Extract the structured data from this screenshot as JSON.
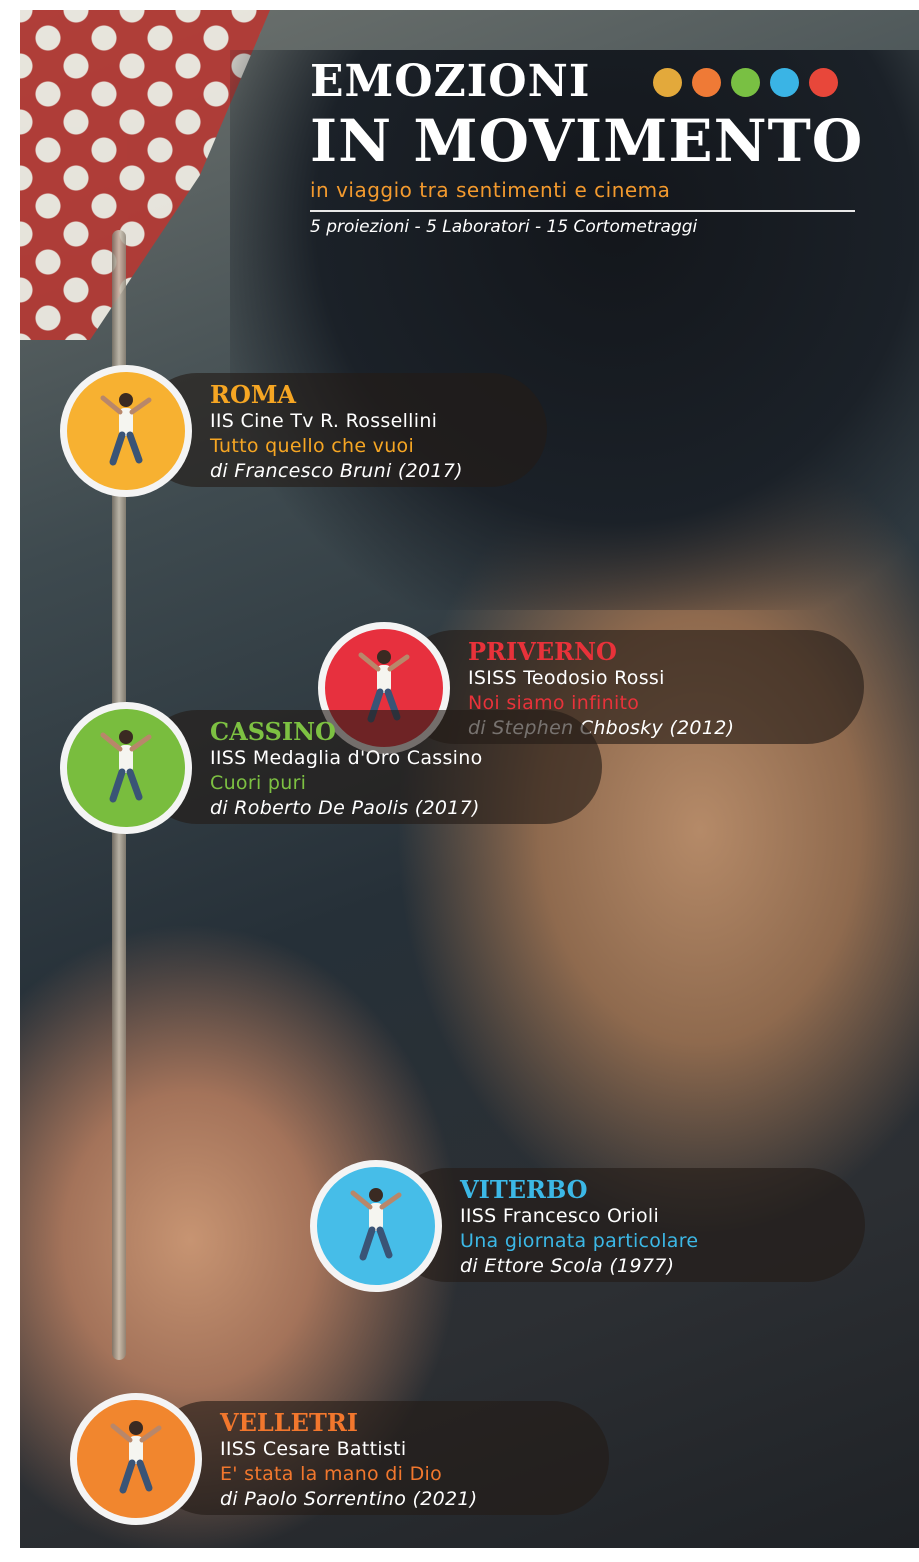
{
  "title": {
    "line1": "EMOZIONI",
    "line2": "IN MOVIMENTO",
    "tagline": "in viaggio tra sentimenti e cinema",
    "subtitle": "5 proiezioni - 5 Laboratori - 15 Cortometraggi",
    "dot_colors": [
      "#e3a93b",
      "#ef7a36",
      "#79c043",
      "#3ab4e5",
      "#e8473a"
    ]
  },
  "events": [
    {
      "city": "ROMA",
      "school": "IIS Cine Tv R. Rossellini",
      "film": "Tutto quello che vuoi",
      "director": "di Francesco Bruni (2017)",
      "color": "#f6a623",
      "circle_color": "#f7b131"
    },
    {
      "city": "PRIVERNO",
      "school": "ISISS Teodosio Rossi",
      "film": "Noi siamo infinito",
      "director": "di Stephen Chbosky (2012)",
      "color": "#e8323a",
      "circle_color": "#e7303e"
    },
    {
      "city": "CASSINO",
      "school": "IISS Medaglia d'Oro Cassino",
      "film": "Cuori puri",
      "director": "di Roberto De Paolis (2017)",
      "color": "#7dc142",
      "circle_color": "#79bd3e"
    },
    {
      "city": "VITERBO",
      "school": "IISS Francesco Orioli",
      "film": "Una giornata particolare",
      "director": "di Ettore Scola (1977)",
      "color": "#3cb8e6",
      "circle_color": "#46bde8"
    },
    {
      "city": "VELLETRI",
      "school": "IISS Cesare Battisti",
      "film": "E' stata la mano di Dio",
      "director": "di Paolo Sorrentino (2021)",
      "color": "#f2772d",
      "circle_color": "#f1862e"
    }
  ]
}
